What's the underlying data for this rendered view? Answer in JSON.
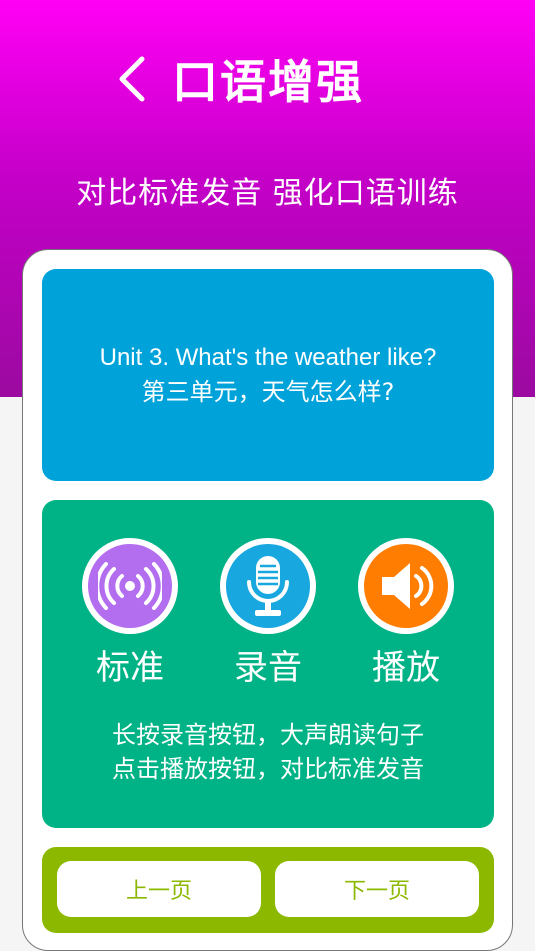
{
  "header": {
    "title": "口语增强",
    "subtitle": "对比标准发音  强化口语训练"
  },
  "sentence": {
    "english": "Unit 3. What's the weather like?",
    "chinese": "第三单元，天气怎么样?"
  },
  "controls": {
    "standard_label": "标准",
    "record_label": "录音",
    "play_label": "播放"
  },
  "hint": {
    "line1": "长按录音按钮，大声朗读句子",
    "line2": "点击播放按钮，对比标准发音"
  },
  "nav": {
    "prev_label": "上一页",
    "next_label": "下一页"
  },
  "colors": {
    "header_gradient_top": "#ff00f5",
    "header_gradient_bottom": "#9b0aa0",
    "sentence_bg": "#00a3d9",
    "control_bg": "#00b386",
    "nav_bg": "#8cb800",
    "standard_icon": "#b36ef0",
    "record_icon": "#18a7de",
    "play_icon": "#ff7d00"
  },
  "icons": {
    "back": "chevron-left-icon",
    "standard": "broadcast-icon",
    "record": "microphone-icon",
    "play": "speaker-icon"
  }
}
